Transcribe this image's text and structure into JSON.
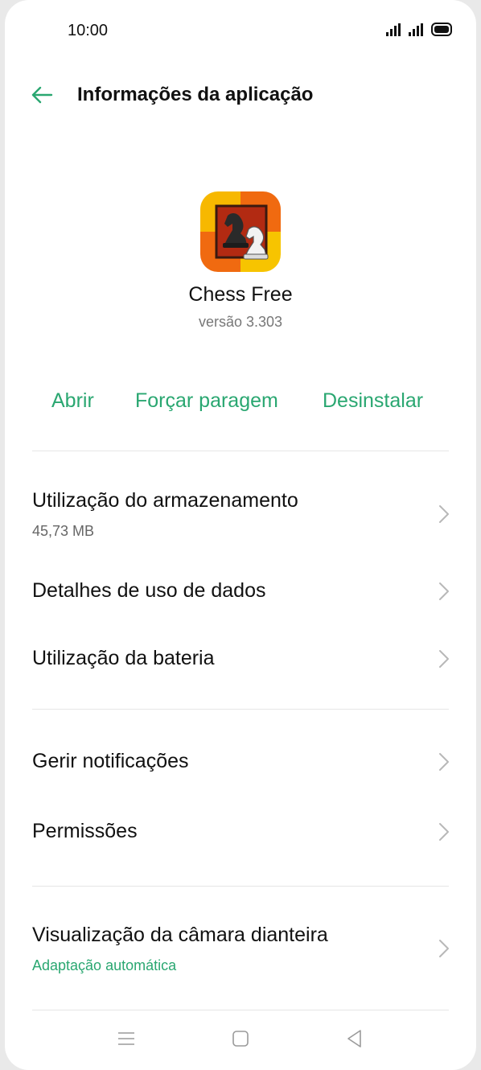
{
  "status_bar": {
    "time": "10:00"
  },
  "header": {
    "title": "Informações da aplicação"
  },
  "app": {
    "name": "Chess Free",
    "version": "versão 3.303"
  },
  "actions": {
    "open": "Abrir",
    "force_stop": "Forçar paragem",
    "uninstall": "Desinstalar"
  },
  "settings": {
    "storage": {
      "label": "Utilização do armazenamento",
      "value": "45,73 MB"
    },
    "data_usage": {
      "label": "Detalhes de uso de dados"
    },
    "battery": {
      "label": "Utilização da bateria"
    },
    "notifications": {
      "label": "Gerir notificações"
    },
    "permissions": {
      "label": "Permissões"
    },
    "front_camera": {
      "label": "Visualização da câmara dianteira",
      "value": "Adaptação automática"
    }
  },
  "colors": {
    "accent": "#2aa771",
    "text": "#111111",
    "secondary": "#777777"
  },
  "icons": [
    "back-arrow-icon",
    "chevron-right-icon",
    "menu-nav-icon",
    "home-nav-icon",
    "back-nav-icon",
    "signal-icon",
    "battery-icon"
  ]
}
